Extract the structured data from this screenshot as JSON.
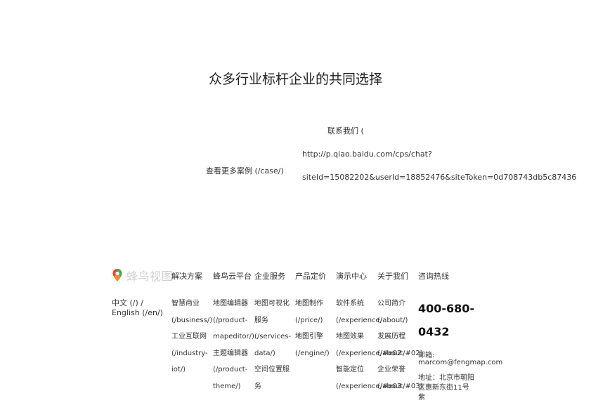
{
  "headline": "众多行业标杆企业的共同选择",
  "more_cases": "查看更多案例 (/case/)",
  "contact": {
    "line1": "联系我们 (",
    "line2": "http://p.qiao.baidu.com/cps/chat?",
    "line3": "siteId=15082202&userId=18852476&siteToken=0d708743db5c87436"
  },
  "footer": {
    "logo_text": "蜂鸟视图",
    "lang": "中文 (/) / English (/en/)",
    "columns": [
      {
        "title": "解决方案",
        "items": [
          "智慧商业",
          "(/business/)",
          "工业互联网",
          "(/industry-",
          "iot/)"
        ]
      },
      {
        "title": "蜂鸟云平台",
        "items": [
          "地图编辑器",
          "(/product-",
          "mapeditor/)",
          "主题编辑器",
          "(/product-",
          "theme/)"
        ]
      },
      {
        "title": "企业服务",
        "items": [
          "地图可视化",
          "服务",
          "(/services-",
          "data/)",
          "空间位置服",
          "务"
        ]
      },
      {
        "title": "产品定价",
        "items": [
          "地图制作",
          "(/price/)",
          "地图引擎",
          "(/engine/)"
        ]
      },
      {
        "title": "演示中心",
        "items": [
          "软件系统",
          "(/experience/",
          "地图效果",
          "(/experience/#e02",
          "智能定位",
          "(/experience/#e03"
        ]
      },
      {
        "title": "关于我们",
        "items": [
          "公司简介",
          "(/about/)",
          "发展历程",
          "(/about/#02)",
          "企业荣誉",
          "(/about/#03)"
        ]
      }
    ],
    "hotline": {
      "title": "咨询热线",
      "number_line1": "400-680-",
      "number_line2": "0432",
      "email_label": "邮箱:",
      "email": "marcom@fengmap.com",
      "address": "地址：北京市朝阳区惠新东街11号紫"
    }
  }
}
